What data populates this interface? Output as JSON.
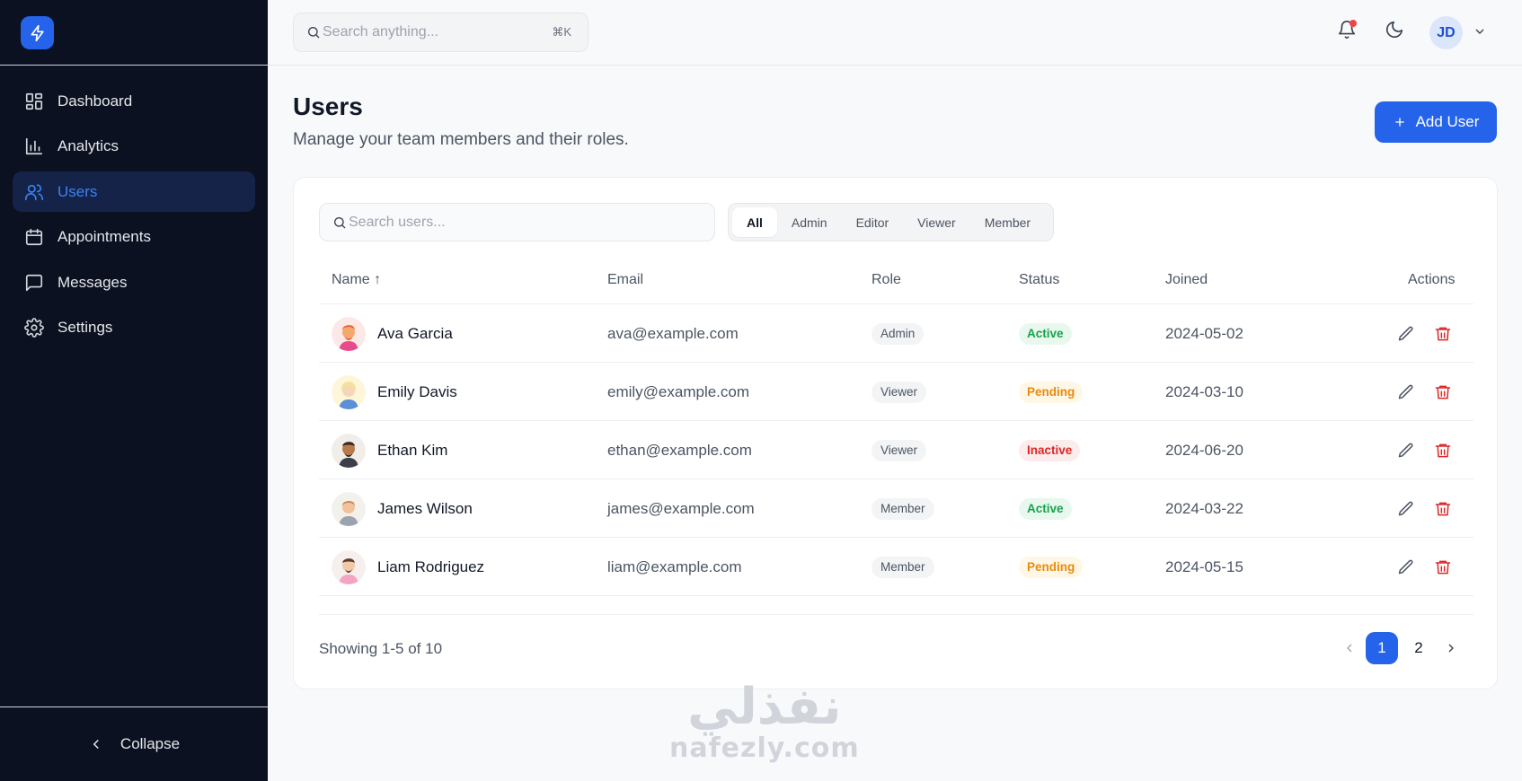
{
  "sidebar": {
    "items": [
      {
        "label": "Dashboard",
        "icon": "dashboard-icon"
      },
      {
        "label": "Analytics",
        "icon": "bar-chart-icon"
      },
      {
        "label": "Users",
        "icon": "users-icon"
      },
      {
        "label": "Appointments",
        "icon": "calendar-icon"
      },
      {
        "label": "Messages",
        "icon": "message-icon"
      },
      {
        "label": "Settings",
        "icon": "gear-icon"
      }
    ],
    "active": "Users",
    "collapse_label": "Collapse"
  },
  "topbar": {
    "search_placeholder": "Search anything...",
    "shortcut": "⌘K",
    "avatar_initials": "JD"
  },
  "page": {
    "title": "Users",
    "subtitle": "Manage your team members and their roles.",
    "add_label": "Add User"
  },
  "users_card": {
    "search_placeholder": "Search users...",
    "filters": [
      "All",
      "Admin",
      "Editor",
      "Viewer",
      "Member"
    ],
    "active_filter": "All",
    "columns": {
      "name": "Name ↑",
      "email": "Email",
      "role": "Role",
      "status": "Status",
      "joined": "Joined",
      "actions": "Actions"
    },
    "rows": [
      {
        "name": "Ava Garcia",
        "email": "ava@example.com",
        "role": "Admin",
        "status": "Active",
        "joined": "2024-05-02"
      },
      {
        "name": "Emily Davis",
        "email": "emily@example.com",
        "role": "Viewer",
        "status": "Pending",
        "joined": "2024-03-10"
      },
      {
        "name": "Ethan Kim",
        "email": "ethan@example.com",
        "role": "Viewer",
        "status": "Inactive",
        "joined": "2024-06-20"
      },
      {
        "name": "James Wilson",
        "email": "james@example.com",
        "role": "Member",
        "status": "Active",
        "joined": "2024-03-22"
      },
      {
        "name": "Liam Rodriguez",
        "email": "liam@example.com",
        "role": "Member",
        "status": "Pending",
        "joined": "2024-05-15"
      }
    ],
    "showing": "Showing 1-5 of 10",
    "pages": [
      "1",
      "2"
    ],
    "current_page": "1"
  },
  "watermark": {
    "arabic": "نفذلي",
    "latin": "nafezly.com"
  },
  "colors": {
    "accent": "#2563eb",
    "sidebar_bg": "#0b1120",
    "active": "#16a34a",
    "pending": "#ea8a0c",
    "inactive": "#dc2626",
    "delete": "#dc2626"
  }
}
